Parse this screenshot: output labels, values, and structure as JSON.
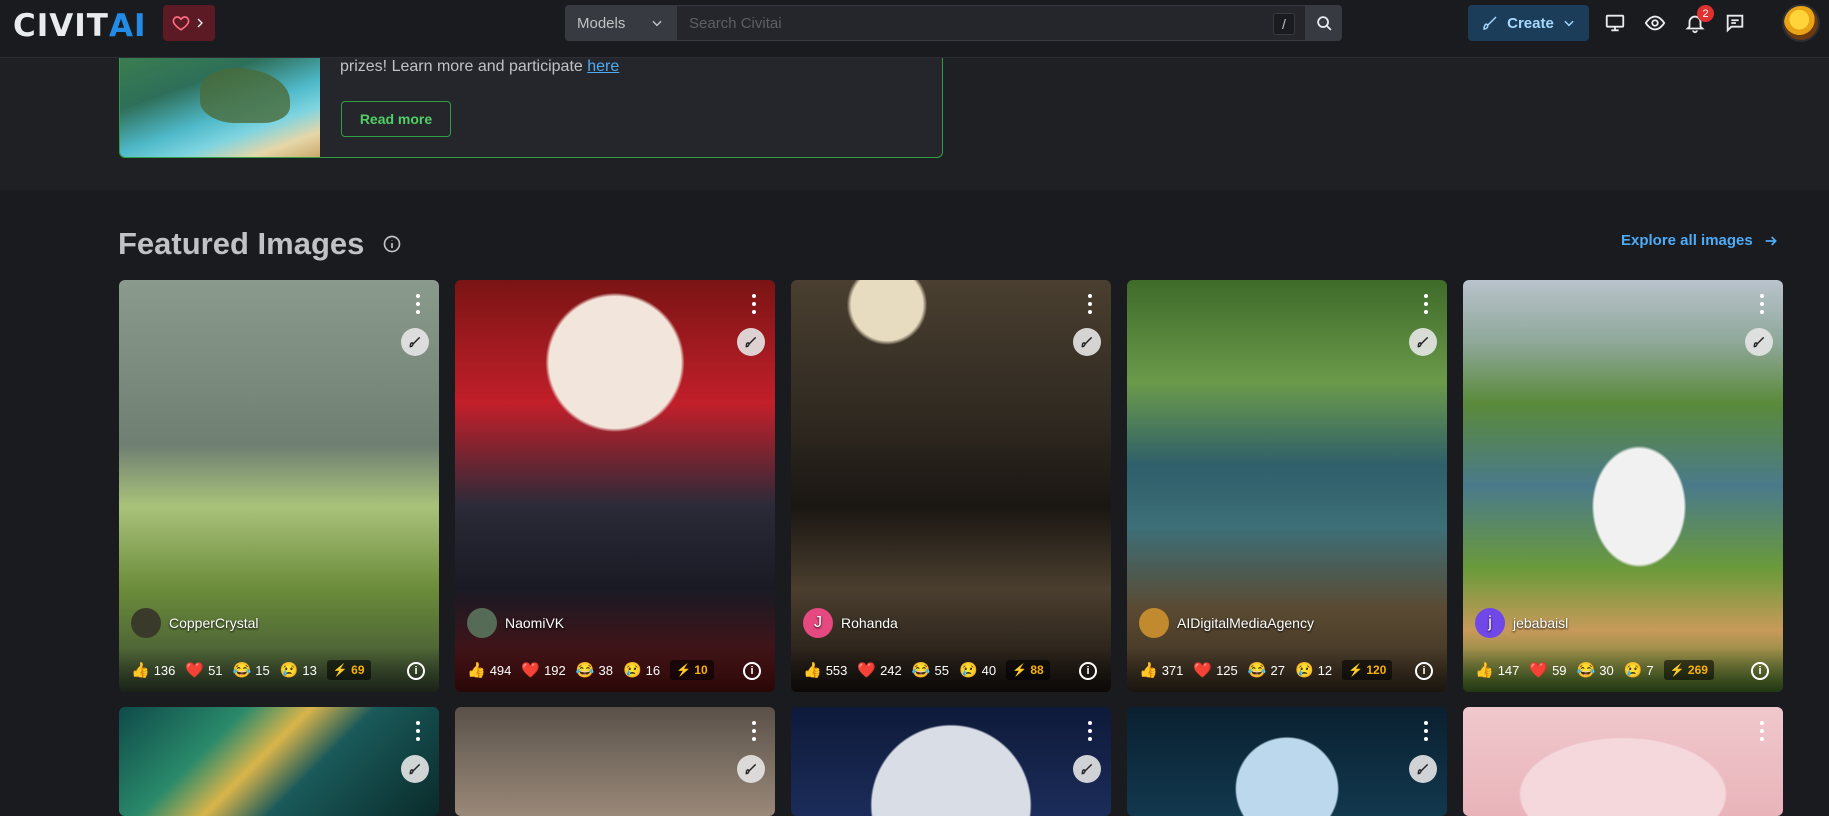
{
  "header": {
    "logo_left": "CIVIT",
    "logo_right": "AI",
    "search_category": "Models",
    "search_placeholder": "Search Civitai",
    "search_shortcut": "/",
    "create_label": "Create",
    "notification_count": "2"
  },
  "announcement": {
    "text_prefix": "prizes! Learn more and participate ",
    "link_text": "here",
    "read_more": "Read more"
  },
  "featured": {
    "title": "Featured Images",
    "explore_label": "Explore all images"
  },
  "cards": [
    {
      "user": "CopperCrystal",
      "avatar_letter": "",
      "likes": "136",
      "hearts": "51",
      "laughs": "15",
      "cries": "13",
      "buzz": "69"
    },
    {
      "user": "NaomiVK",
      "avatar_letter": "",
      "likes": "494",
      "hearts": "192",
      "laughs": "38",
      "cries": "16",
      "buzz": "10"
    },
    {
      "user": "Rohanda",
      "avatar_letter": "J",
      "likes": "553",
      "hearts": "242",
      "laughs": "55",
      "cries": "40",
      "buzz": "88"
    },
    {
      "user": "AIDigitalMediaAgency",
      "avatar_letter": "",
      "likes": "371",
      "hearts": "125",
      "laughs": "27",
      "cries": "12",
      "buzz": "120"
    },
    {
      "user": "jebabaisl",
      "avatar_letter": "j",
      "likes": "147",
      "hearts": "59",
      "laughs": "30",
      "cries": "7",
      "buzz": "269"
    }
  ],
  "colors": {
    "accent_blue": "#228be6",
    "accent_green": "#2f9e44",
    "buzz_yellow": "#fab005"
  }
}
